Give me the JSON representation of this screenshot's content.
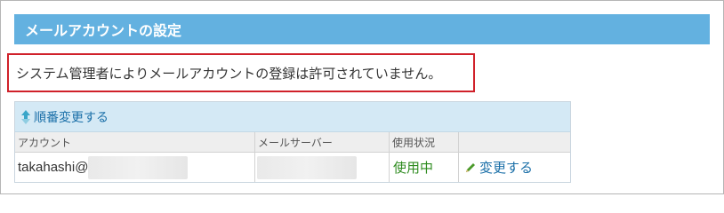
{
  "section": {
    "title": "メールアカウントの設定"
  },
  "notice": {
    "message": "システム管理者によりメールアカウントの登録は許可されていません。"
  },
  "reorder": {
    "label": "順番変更する",
    "icon": "up-down-arrow-icon"
  },
  "table": {
    "headers": [
      "アカウント",
      "メールサーバー",
      "使用状況",
      ""
    ],
    "rows": [
      {
        "account": "takahashi@",
        "server": "",
        "status": "使用中",
        "action": "変更する"
      }
    ]
  },
  "colors": {
    "header_bg": "#63b1e0",
    "notice_border": "#d0212a",
    "link": "#1a6fa8",
    "status_active": "#2e8b1f"
  }
}
